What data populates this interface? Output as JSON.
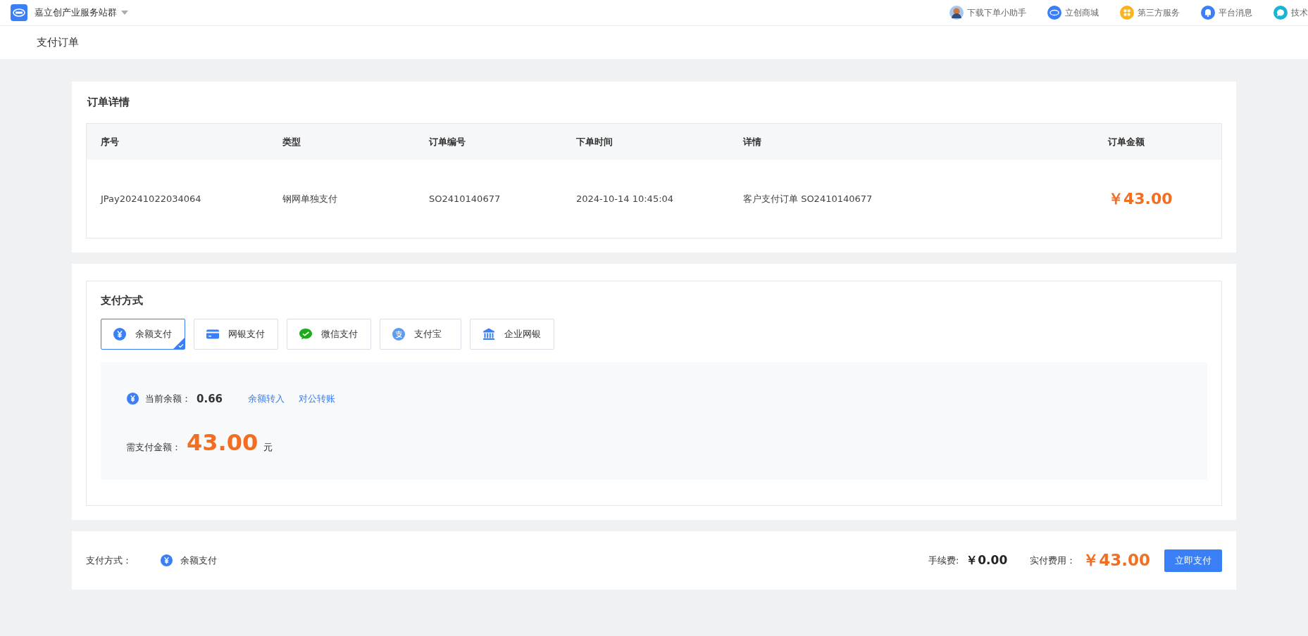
{
  "topbar": {
    "site_name": "嘉立创产业服务站群",
    "links": [
      {
        "kind": "avatar",
        "label": "下载下单小助手"
      },
      {
        "kind": "mall",
        "label": "立创商城"
      },
      {
        "kind": "grid",
        "label": "第三方服务"
      },
      {
        "kind": "bell",
        "label": "平台消息"
      },
      {
        "kind": "chat",
        "label": "技术"
      }
    ]
  },
  "page_title": "支付订单",
  "order": {
    "title": "订单详情",
    "columns": [
      "序号",
      "类型",
      "订单编号",
      "下单时间",
      "详情",
      "订单金额"
    ],
    "rows": [
      {
        "serial": "JPay20241022034064",
        "type": "钢网单独支付",
        "order_no": "SO2410140677",
        "time": "2024-10-14 10:45:04",
        "detail": "客户支付订单 SO2410140677",
        "amount": "￥43.00"
      }
    ]
  },
  "payment": {
    "title": "支付方式",
    "methods": [
      {
        "kind": "balance",
        "label": "余额支付",
        "selected": true
      },
      {
        "kind": "card",
        "label": "网银支付",
        "selected": false
      },
      {
        "kind": "wechat",
        "label": "微信支付",
        "selected": false
      },
      {
        "kind": "alipay",
        "label": "支付宝",
        "selected": false
      },
      {
        "kind": "bank",
        "label": "企业网银",
        "selected": false
      }
    ],
    "balance_label": "当前余额：",
    "balance": "0.66",
    "links": [
      "余额转入",
      "对公转账"
    ],
    "due_label": "需支付金额：",
    "due": "43.00",
    "due_unit": "元"
  },
  "footer": {
    "method_label": "支付方式：",
    "method": "余额支付",
    "fee_label": "手续费:",
    "fee": "￥0.00",
    "total_label": "实付费用：",
    "total": "￥43.00",
    "pay_button": "立即支付"
  }
}
